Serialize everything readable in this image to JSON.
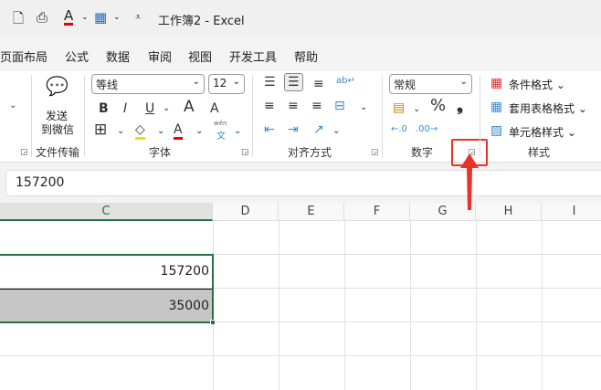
{
  "title_bar": {
    "title": "工作簿2  -  Excel",
    "icons": [
      "print-preview-icon",
      "print-icon",
      "font-color-icon",
      "borders-icon",
      "customize-qat-icon"
    ]
  },
  "menu_tabs": [
    "页面布局",
    "公式",
    "数据",
    "审阅",
    "视图",
    "开发工具",
    "帮助"
  ],
  "ribbon": {
    "wechat": {
      "label_line1": "发送",
      "label_line2": "到微信",
      "group": "文件传输"
    },
    "font": {
      "name": "等线",
      "size": "12",
      "bold": "B",
      "italic": "I",
      "underline": "U",
      "grow": "A",
      "shrink": "A",
      "font_color": "A",
      "phonetic_top": "wén",
      "phonetic_bottom": "文",
      "group": "字体"
    },
    "alignment": {
      "group": "对齐方式"
    },
    "number": {
      "format": "常规",
      "percent": "%",
      "comma": "❟",
      "group": "数字"
    },
    "styles": {
      "conditional": "条件格式",
      "table": "套用表格格式",
      "cell": "单元格样式",
      "group": "样式"
    }
  },
  "formula_bar": {
    "value": "157200"
  },
  "columns": [
    "C",
    "D",
    "E",
    "F",
    "G",
    "H",
    "I"
  ],
  "cells": {
    "c2": "157200",
    "c3": "35000"
  },
  "colors": {
    "accent": "#217346",
    "highlight": "#e8332a",
    "selection_fill": "#c6c6c6"
  }
}
